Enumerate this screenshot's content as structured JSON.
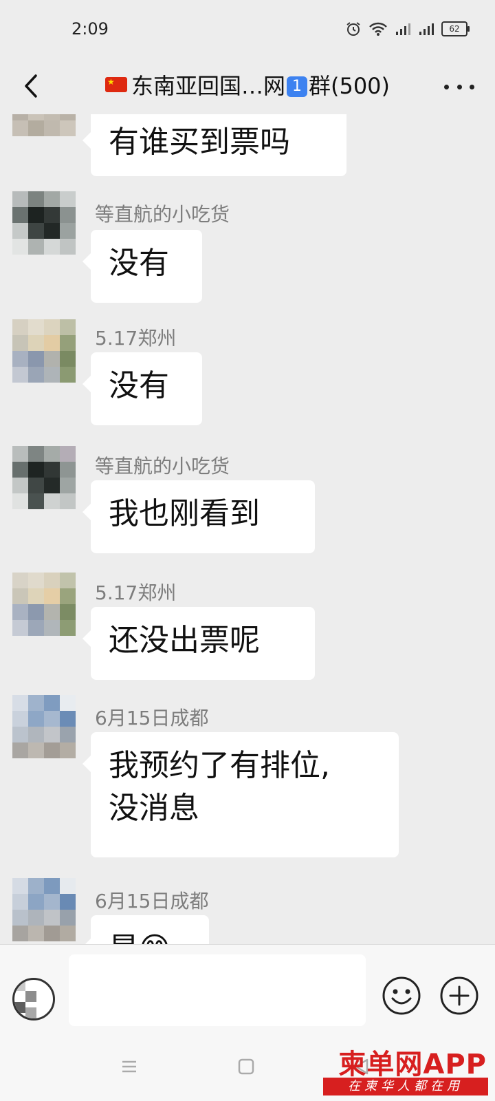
{
  "status_bar": {
    "time": "2:09",
    "battery": "62"
  },
  "header": {
    "title_before_badge": "东南亚回国…网",
    "badge": "1",
    "title_after_badge": "群(500)"
  },
  "messages": [
    {
      "sender": "",
      "text": "有谁买到票吗"
    },
    {
      "sender": "等直航的小吃货",
      "text": "没有"
    },
    {
      "sender": "5.17郑州",
      "text": "没有"
    },
    {
      "sender": "等直航的小吃货",
      "text": "我也刚看到"
    },
    {
      "sender": "5.17郑州",
      "text": "还没出票呢"
    },
    {
      "sender": "6月15日成都",
      "text_line1": "我预约了有排位,",
      "text_line2": "没消息"
    },
    {
      "sender": "6月15日成都",
      "text": "是😊"
    }
  ],
  "input": {
    "placeholder": ""
  },
  "watermark": {
    "main": "柬单网APP",
    "sub": "在柬华人都在用"
  },
  "colors": {
    "background": "#ededed",
    "bubble": "#ffffff",
    "sender_name": "#7d7d7d",
    "watermark_red": "#d71f1f"
  }
}
